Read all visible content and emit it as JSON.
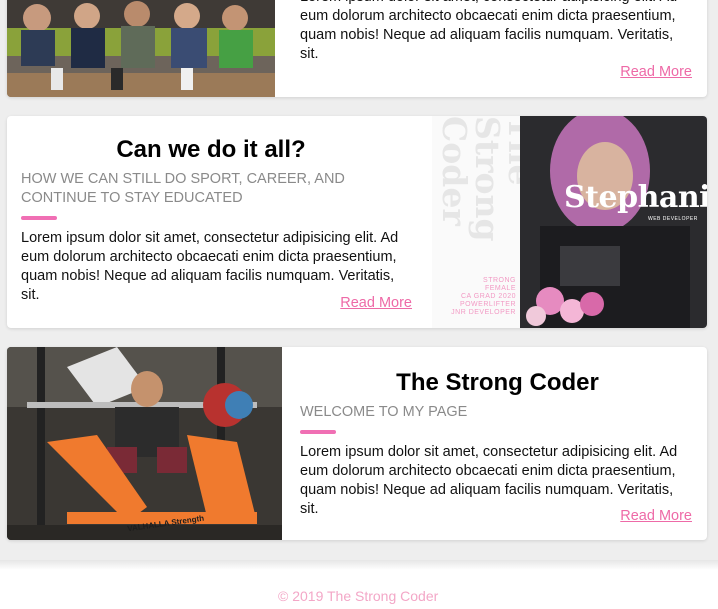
{
  "cards": [
    {
      "body": "Lorem ipsum dolor sit amet, consectetur adipisicing elit. Ad eum dolorum architecto obcaecati enim dicta praesentium, quam nobis! Neque ad aliquam facilis numquam. Veritatis, sit.",
      "read_more": "Read More",
      "image_alt": "Group photo of a team sitting on a bench"
    },
    {
      "title": "Can we do it all?",
      "subtitle": "HOW WE CAN STILL DO SPORT, CAREER, AND CONTINUE TO STAY EDUCATED",
      "body": "Lorem ipsum dolor sit amet, consectetur adipisicing elit. Ad eum dolorum architecto obcaecati enim dicta praesentium, quam nobis! Neque ad aliquam facilis numquam. Veritatis, sit.",
      "read_more": "Read More",
      "poster": {
        "big_text": "The Strong Coder",
        "name": "Stephanie",
        "role": "WEB DEVELOPER",
        "list": [
          "STRONG",
          "FEMALE",
          "CA GRAD 2020",
          "POWERLIFTER",
          "JNR DEVELOPER"
        ]
      }
    },
    {
      "title": "The Strong Coder",
      "subtitle": "WELCOME TO MY PAGE",
      "body": "Lorem ipsum dolor sit amet, consectetur adipisicing elit. Ad eum dolorum architecto obcaecati enim dicta praesentium, quam nobis! Neque ad aliquam facilis numquam. Veritatis, sit.",
      "read_more": "Read More",
      "rack_label": "VALHALLA Strength"
    }
  ],
  "footer": {
    "copyright": "© 2019 The Strong Coder"
  },
  "colors": {
    "accent": "#ee6aa7",
    "bar": "#f06fb4",
    "subtitle": "#8a8a8a"
  }
}
